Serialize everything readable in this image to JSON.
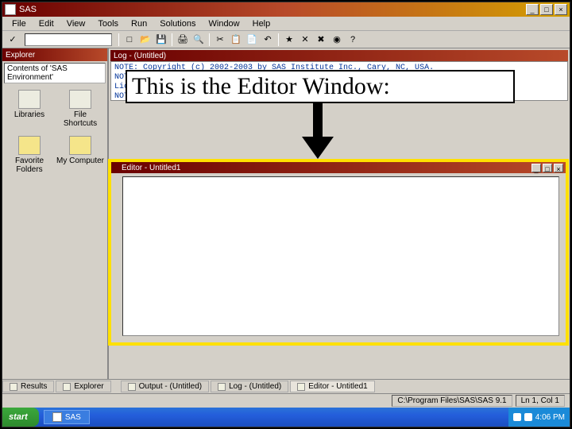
{
  "app": {
    "title": "SAS"
  },
  "window_controls": {
    "min": "_",
    "max": "□",
    "close": "×"
  },
  "menu": [
    "File",
    "Edit",
    "View",
    "Tools",
    "Run",
    "Solutions",
    "Window",
    "Help"
  ],
  "toolbar": {
    "check": "✓",
    "command_value": "",
    "icons": [
      "new-icon",
      "open-icon",
      "save-icon",
      "print-icon",
      "preview-icon",
      "cut-icon",
      "copy-icon",
      "paste-icon",
      "undo-icon",
      "submit-icon",
      "clear-icon",
      "break-icon",
      "help-icon",
      "web-icon"
    ]
  },
  "sidebar": {
    "title": "Explorer",
    "header": "Contents of 'SAS Environment'",
    "items": [
      {
        "label": "Libraries",
        "style": "plain"
      },
      {
        "label": "File Shortcuts",
        "style": "plain"
      },
      {
        "label": "Favorite Folders",
        "style": "yellow"
      },
      {
        "label": "My Computer",
        "style": "yellow"
      }
    ]
  },
  "log": {
    "title": "Log - (Untitled)",
    "lines": [
      "NOTE: Copyright (c) 2002-2003 by SAS Institute Inc., Cary, NC, USA.",
      "NOTE: SAS (r) 9.1 (TS1M3)",
      "      Licensed to UNIVERSITY OF MINNESOTA, Site 0009012001.",
      "NOTE: This session is executing on the XP_HOME  platform."
    ]
  },
  "annotation": {
    "text": "This is the Editor Window:"
  },
  "editor": {
    "title": "Editor - Untitled1"
  },
  "bottom_tabs": {
    "left": [
      {
        "label": "Results"
      },
      {
        "label": "Explorer"
      }
    ],
    "right": [
      {
        "label": "Output - (Untitled)"
      },
      {
        "label": "Log - (Untitled)"
      },
      {
        "label": "Editor - Untitled1"
      }
    ]
  },
  "status": {
    "path": "C:\\Program Files\\SAS\\SAS 9.1",
    "pos": "Ln 1, Col 1"
  },
  "taskbar": {
    "start": "start",
    "tasks": [
      {
        "label": "SAS"
      }
    ],
    "time": "4:06 PM"
  }
}
